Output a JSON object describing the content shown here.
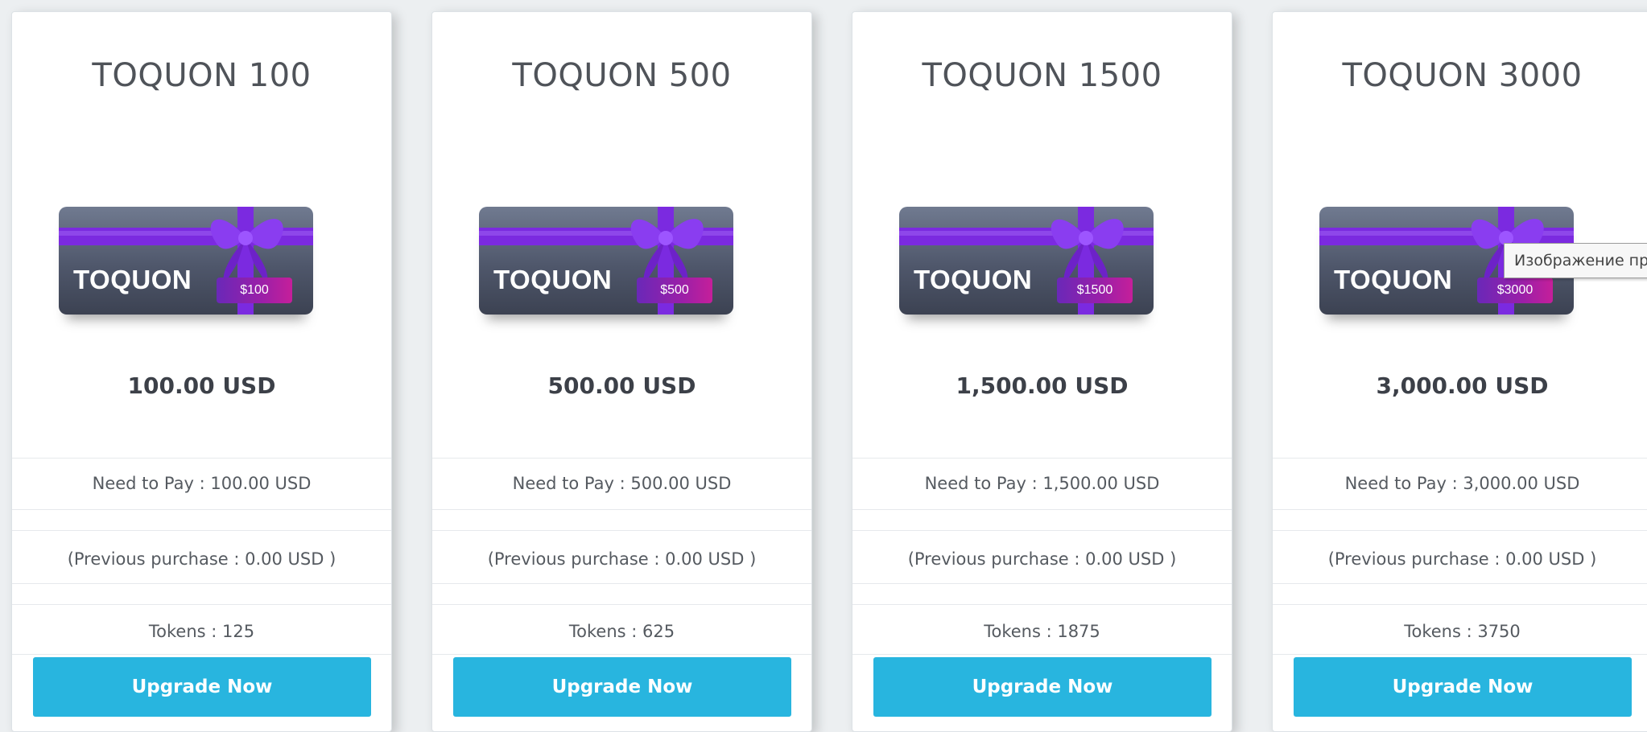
{
  "colors": {
    "button": "#28b5df",
    "page_bg": "#eceff1",
    "card_bg": "#ffffff",
    "gift_ribbon": "#7b2ae0",
    "gift_badge": "#9b1fa8"
  },
  "cards": [
    {
      "title": "TOQUON 100",
      "gift_brand": "TOQUON",
      "gift_amount": "$100",
      "price": "100.00 USD",
      "need_to_pay": "Need to Pay : 100.00 USD",
      "previous_purchase": "(Previous purchase : 0.00 USD )",
      "tokens": "Tokens : 125",
      "button_label": "Upgrade Now"
    },
    {
      "title": "TOQUON 500",
      "gift_brand": "TOQUON",
      "gift_amount": "$500",
      "price": "500.00 USD",
      "need_to_pay": "Need to Pay : 500.00 USD",
      "previous_purchase": "(Previous purchase : 0.00 USD )",
      "tokens": "Tokens : 625",
      "button_label": "Upgrade Now"
    },
    {
      "title": "TOQUON 1500",
      "gift_brand": "TOQUON",
      "gift_amount": "$1500",
      "price": "1,500.00 USD",
      "need_to_pay": "Need to Pay : 1,500.00 USD",
      "previous_purchase": "(Previous purchase : 0.00 USD )",
      "tokens": "Tokens : 1875",
      "button_label": "Upgrade Now"
    },
    {
      "title": "TOQUON 3000",
      "gift_brand": "TOQUON",
      "gift_amount": "$3000",
      "price": "3,000.00 USD",
      "need_to_pay": "Need to Pay : 3,000.00 USD",
      "previous_purchase": "(Previous purchase : 0.00 USD )",
      "tokens": "Tokens : 3750",
      "button_label": "Upgrade Now"
    }
  ],
  "tooltip": {
    "text": "Изображение пр"
  }
}
